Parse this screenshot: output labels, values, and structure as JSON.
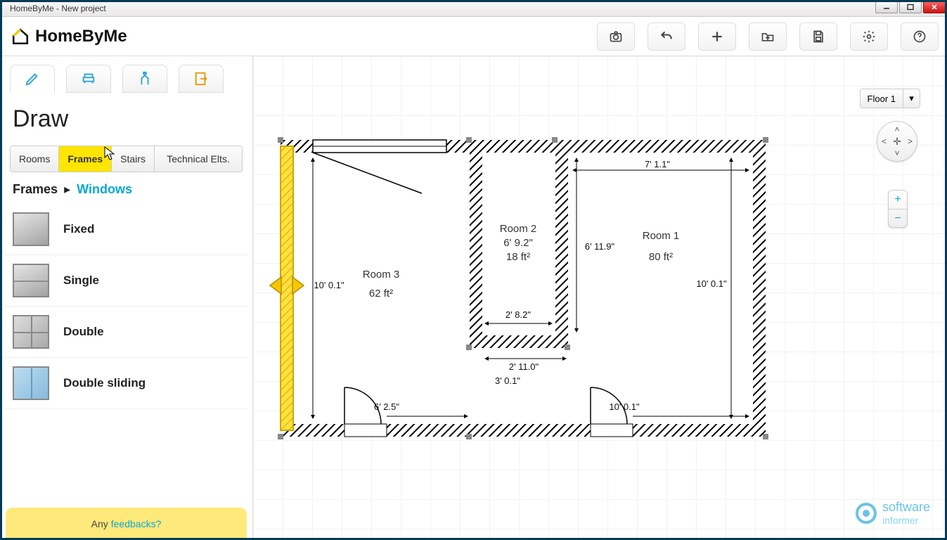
{
  "window": {
    "title": "HomeByMe - New project"
  },
  "brand": "HomeByMe",
  "toolbar": {
    "camera": "camera",
    "undo": "undo",
    "add": "add",
    "open": "open",
    "save": "save",
    "settings": "settings",
    "help": "help"
  },
  "sidebar": {
    "section_title": "Draw",
    "mode_tabs": [
      "draw",
      "furnish",
      "decorate",
      "export"
    ],
    "cat_tabs": [
      "Rooms",
      "Frames",
      "Stairs",
      "Technical Elts."
    ],
    "cat_active": 1,
    "breadcrumb": {
      "root": "Frames",
      "current": "Windows"
    },
    "items": [
      {
        "label": "Fixed",
        "thumb": "fixed"
      },
      {
        "label": "Single",
        "thumb": "single"
      },
      {
        "label": "Double",
        "thumb": "double"
      },
      {
        "label": "Double sliding",
        "thumb": "sliding"
      }
    ],
    "feedback": {
      "prefix": "Any",
      "link": "feedbacks?"
    }
  },
  "canvas": {
    "floor_label": "Floor 1",
    "rooms": [
      {
        "name": "Room 1",
        "area": "80 ft²"
      },
      {
        "name": "Room 2",
        "width": "6' 9.2\"",
        "area": "18 ft²"
      },
      {
        "name": "Room 3",
        "area": "62 ft²"
      }
    ],
    "dims": {
      "r1_top": "7' 1.1\"",
      "r1_left": "6' 11.9\"",
      "r1_right": "10' 0.1\"",
      "r3_left": "10' 0.1\"",
      "r2_bottom": "2' 8.2\"",
      "mid_bottom1": "2' 11.0\"",
      "mid_bottom2": "3' 0.1\"",
      "door_r3": "6' 2.5\"",
      "door_r1": "10' 0.1\""
    }
  },
  "watermark": {
    "line1": "software",
    "line2": "informer"
  }
}
